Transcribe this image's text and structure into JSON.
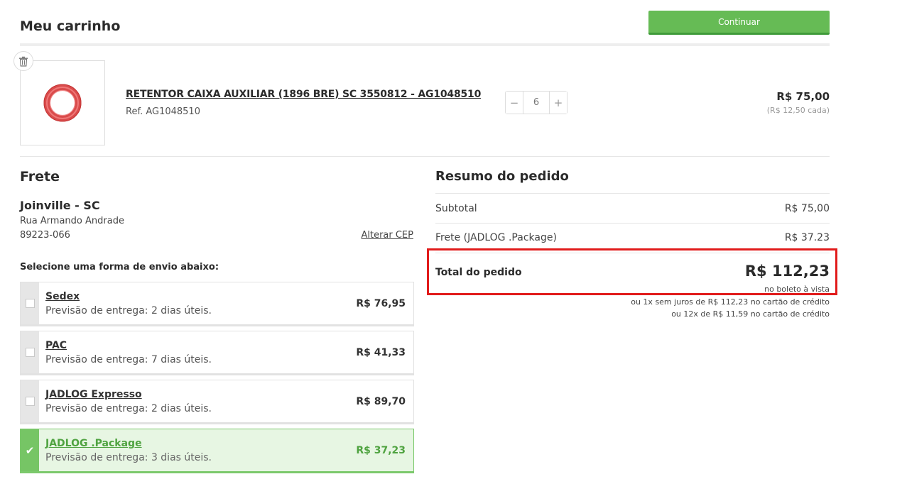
{
  "header": {
    "title": "Meu carrinho",
    "continue_label": "Continuar"
  },
  "cart": {
    "items": [
      {
        "name": "RETENTOR CAIXA AUXILIAR (1896 BRE) SC 3550812 - AG1048510",
        "ref": "Ref. AG1048510",
        "quantity": "6",
        "qty_minus": "−",
        "qty_plus": "+",
        "total_price": "R$ 75,00",
        "unit_price": "(R$ 12,50 cada)"
      }
    ]
  },
  "shipping": {
    "title": "Frete",
    "city": "Joinville - SC",
    "street": "Rua Armando Andrade",
    "cep": "89223-066",
    "change_cep_label": "Alterar CEP",
    "prompt": "Selecione uma forma de envio abaixo:",
    "options": [
      {
        "name": "Sedex",
        "eta": "Previsão de entrega: 2 dias úteis.",
        "price": "R$ 76,95"
      },
      {
        "name": "PAC",
        "eta": "Previsão de entrega: 7 dias úteis.",
        "price": "R$ 41,33"
      },
      {
        "name": "JADLOG Expresso",
        "eta": "Previsão de entrega: 2 dias úteis.",
        "price": "R$ 89,70"
      },
      {
        "name": "JADLOG .Package",
        "eta": "Previsão de entrega: 3 dias úteis.",
        "price": "R$ 37,23"
      }
    ],
    "selected_index": 3
  },
  "summary": {
    "title": "Resumo do pedido",
    "subtotal_label": "Subtotal",
    "subtotal_value": "R$ 75,00",
    "freight_label": "Frete (JADLOG .Package)",
    "freight_value": "R$ 37.23",
    "total_label": "Total do pedido",
    "total_value": "R$ 112,23",
    "note_boleto": "no boleto à vista",
    "note_1x": "ou 1x sem juros de R$ 112,23 no cartão de crédito",
    "note_12x": "ou 12x de R$ 11,59 no cartão de crédito"
  },
  "colors": {
    "accent_green": "#66bb55",
    "highlight_red": "#e11b1b"
  }
}
